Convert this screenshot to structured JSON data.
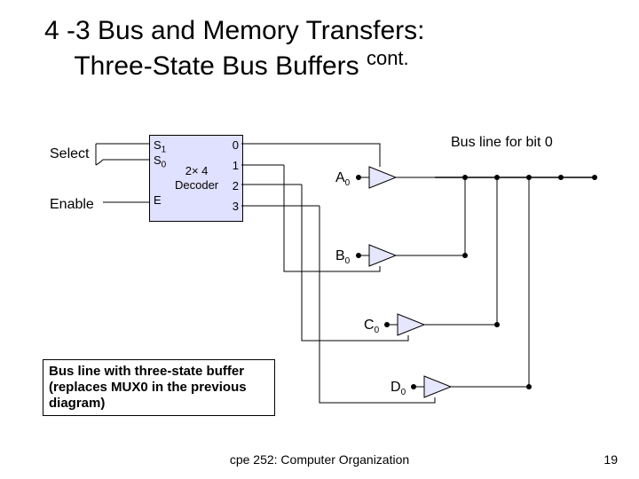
{
  "title_line1": "4 -3 Bus and Memory Transfers:",
  "title_line2_a": "Three-State Bus Buffers ",
  "title_line2_sup": "cont.",
  "labels": {
    "select": "Select",
    "enable": "Enable",
    "s1": "S",
    "s1_sub": "1",
    "s0": "S",
    "s0_sub": "0",
    "e": "E",
    "decoder_l1": "2× 4",
    "decoder_l2": "Decoder",
    "out0": "0",
    "out1": "1",
    "out2": "2",
    "out3": "3",
    "a0": "A",
    "a0_sub": "0",
    "b0": "B",
    "b0_sub": "0",
    "c0": "C",
    "c0_sub": "0",
    "d0": "D",
    "d0_sub": "0",
    "busline": "Bus line for bit 0"
  },
  "caption": "Bus line with three-state buffer (replaces MUX0 in the previous diagram)",
  "footer": "cpe 252: Computer Organization",
  "pagenum": "19",
  "chart_data": {
    "type": "table",
    "title": "Three-state bus buffer circuit for bit 0",
    "decoder": {
      "name": "2×4 Decoder",
      "select_inputs": [
        "S1",
        "S0"
      ],
      "enable_input": "E",
      "outputs": [
        "0",
        "1",
        "2",
        "3"
      ]
    },
    "buffers": [
      {
        "data_in": "A0",
        "enable_from_decoder_output": 0,
        "drives": "Bus line for bit 0"
      },
      {
        "data_in": "B0",
        "enable_from_decoder_output": 1,
        "drives": "Bus line for bit 0"
      },
      {
        "data_in": "C0",
        "enable_from_decoder_output": 2,
        "drives": "Bus line for bit 0"
      },
      {
        "data_in": "D0",
        "enable_from_decoder_output": 3,
        "drives": "Bus line for bit 0"
      }
    ],
    "note": "Bus line with three-state buffer replaces MUX0 in previous diagram"
  }
}
